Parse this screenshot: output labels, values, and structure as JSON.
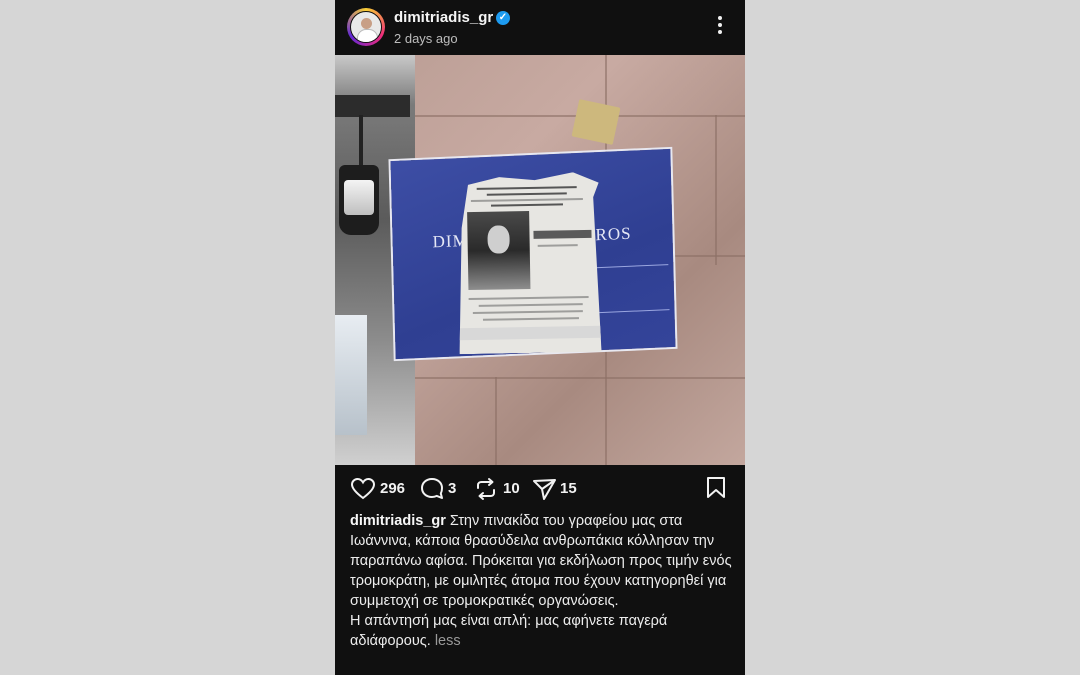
{
  "post": {
    "username": "dimitriadis_gr",
    "time": "2 days ago",
    "verified": true,
    "menu_icon": "more-vertical-icon"
  },
  "actions": {
    "likes": "296",
    "comments": "3",
    "reposts": "10",
    "shares": "15"
  },
  "caption": {
    "username": "dimitriadis_gr",
    "text": "Στην πινακίδα του γραφείου μας στα Ιωάννινα, κάποια θρασύδειλα ανθρωπάκια κόλλησαν την παραπάνω αφίσα. Πρόκειται για εκδήλωση προς τιμήν ενός τρομοκράτη, με ομιλητές άτομα που έχουν κατηγορηθεί για συμμετοχή σε τρομοκρατικές οργανώσεις.",
    "text2": "Η απάντησή μας είναι απλή: μας αφήνετε παγερά αδιάφορους.",
    "less": "less"
  },
  "colors": {
    "background": "#101010",
    "verified": "#1d9bf0",
    "sign_blue": "#34449a"
  }
}
